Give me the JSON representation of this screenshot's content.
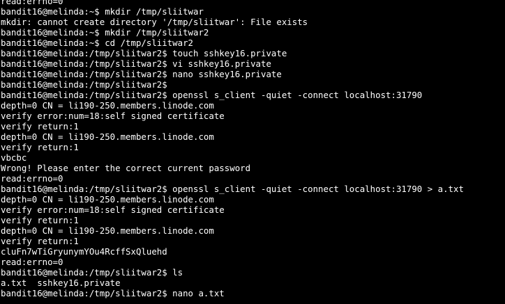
{
  "terminal": {
    "lines": [
      "read:errno=0",
      "bandit16@melinda:~$ mkdir /tmp/sliitwar",
      "mkdir: cannot create directory '/tmp/sliitwar': File exists",
      "bandit16@melinda:~$ mkdir /tmp/sliitwar2",
      "bandit16@melinda:~$ cd /tmp/sliitwar2",
      "bandit16@melinda:/tmp/sliitwar2$ touch sshkey16.private",
      "bandit16@melinda:/tmp/sliitwar2$ vi sshkey16.private",
      "bandit16@melinda:/tmp/sliitwar2$ nano sshkey16.private",
      "bandit16@melinda:/tmp/sliitwar2$",
      "bandit16@melinda:/tmp/sliitwar2$ openssl s_client -quiet -connect localhost:31790",
      "depth=0 CN = li190-250.members.linode.com",
      "verify error:num=18:self signed certificate",
      "verify return:1",
      "depth=0 CN = li190-250.members.linode.com",
      "verify return:1",
      "vbcbc",
      "Wrong! Please enter the correct current password",
      "read:errno=0",
      "bandit16@melinda:/tmp/sliitwar2$ openssl s_client -quiet -connect localhost:31790 > a.txt",
      "depth=0 CN = li190-250.members.linode.com",
      "verify error:num=18:self signed certificate",
      "verify return:1",
      "depth=0 CN = li190-250.members.linode.com",
      "verify return:1",
      "cluFn7wTiGryunymYOu4RcffSxQluehd",
      "read:errno=0",
      "bandit16@melinda:/tmp/sliitwar2$ ls",
      "a.txt  sshkey16.private",
      "bandit16@melinda:/tmp/sliitwar2$ nano a.txt"
    ]
  }
}
